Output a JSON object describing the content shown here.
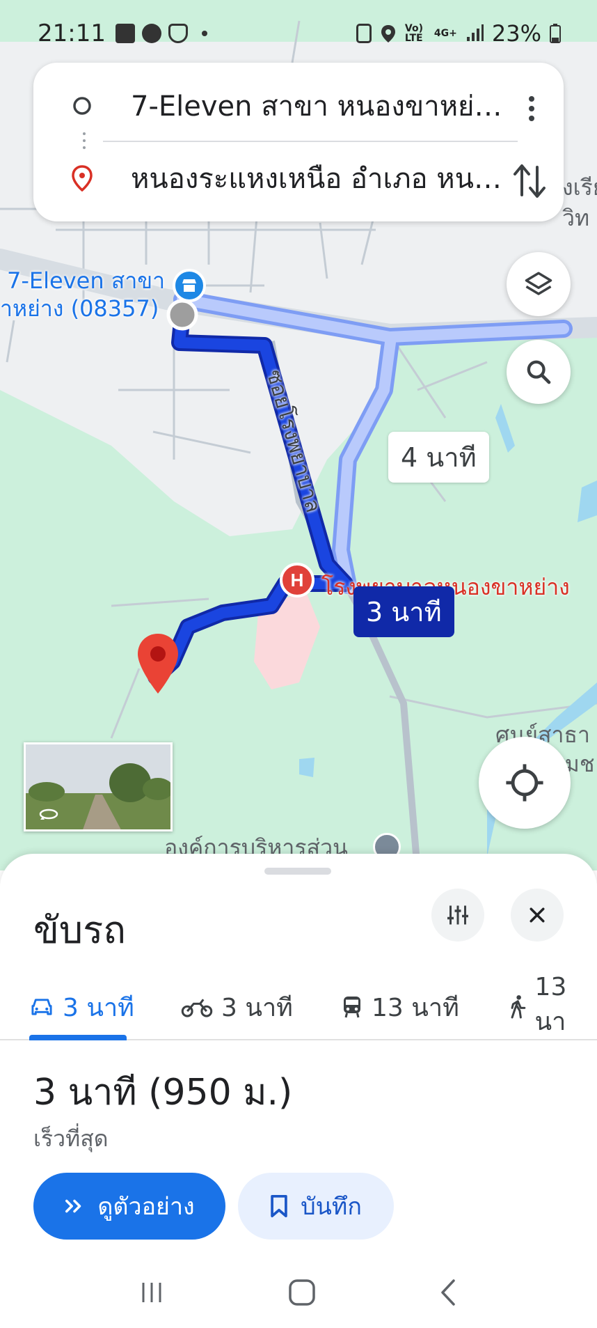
{
  "status_bar": {
    "time": "21:11",
    "battery": "23%",
    "network": "4G+",
    "volte": "Vo) LTE"
  },
  "route_card": {
    "origin": "7-Eleven สาขา หนองขาหย่า...",
    "destination": "หนองระแหงเหนือ อำเภอ หนอ...",
    "origin_icon": "circle-outline-icon",
    "destination_icon": "location-pin-icon"
  },
  "map": {
    "poi_seven_eleven_line1": "7-Eleven สาขา",
    "poi_seven_eleven_line2": "าหย่าง (08357)",
    "road_label": "ซอยโรงพยาบาล",
    "hospital_label": "โรงพยาบาลหนองขาหย่าง",
    "alt_route_time": "4 นาที",
    "main_route_time": "3 นาที",
    "right_label_top": "งเรีย",
    "right_label_top2": "วิท",
    "right_label_bottom": "ศูนย์สาธา",
    "right_label_bottom2": "ชุมช",
    "bottom_label": "องค์การบริหารส่วน",
    "colors": {
      "route_primary": "#1a45e0",
      "route_alt": "#a8c0fb",
      "map_green": "#ccf0dc",
      "hospital_red": "#e0413a"
    }
  },
  "sheet": {
    "title": "ขับรถ",
    "modes": [
      {
        "icon": "car-icon",
        "label": "3 นาที"
      },
      {
        "icon": "motorcycle-icon",
        "label": "3 นาที"
      },
      {
        "icon": "transit-icon",
        "label": "13 นาที"
      },
      {
        "icon": "walk-icon",
        "label": "13 นา"
      }
    ],
    "summary": "3 นาที (950 ม.)",
    "subtitle": "เร็วที่สุด",
    "preview_button": "ดูตัวอย่าง",
    "save_button": "บันทึก",
    "accent": "#1a73e8"
  }
}
